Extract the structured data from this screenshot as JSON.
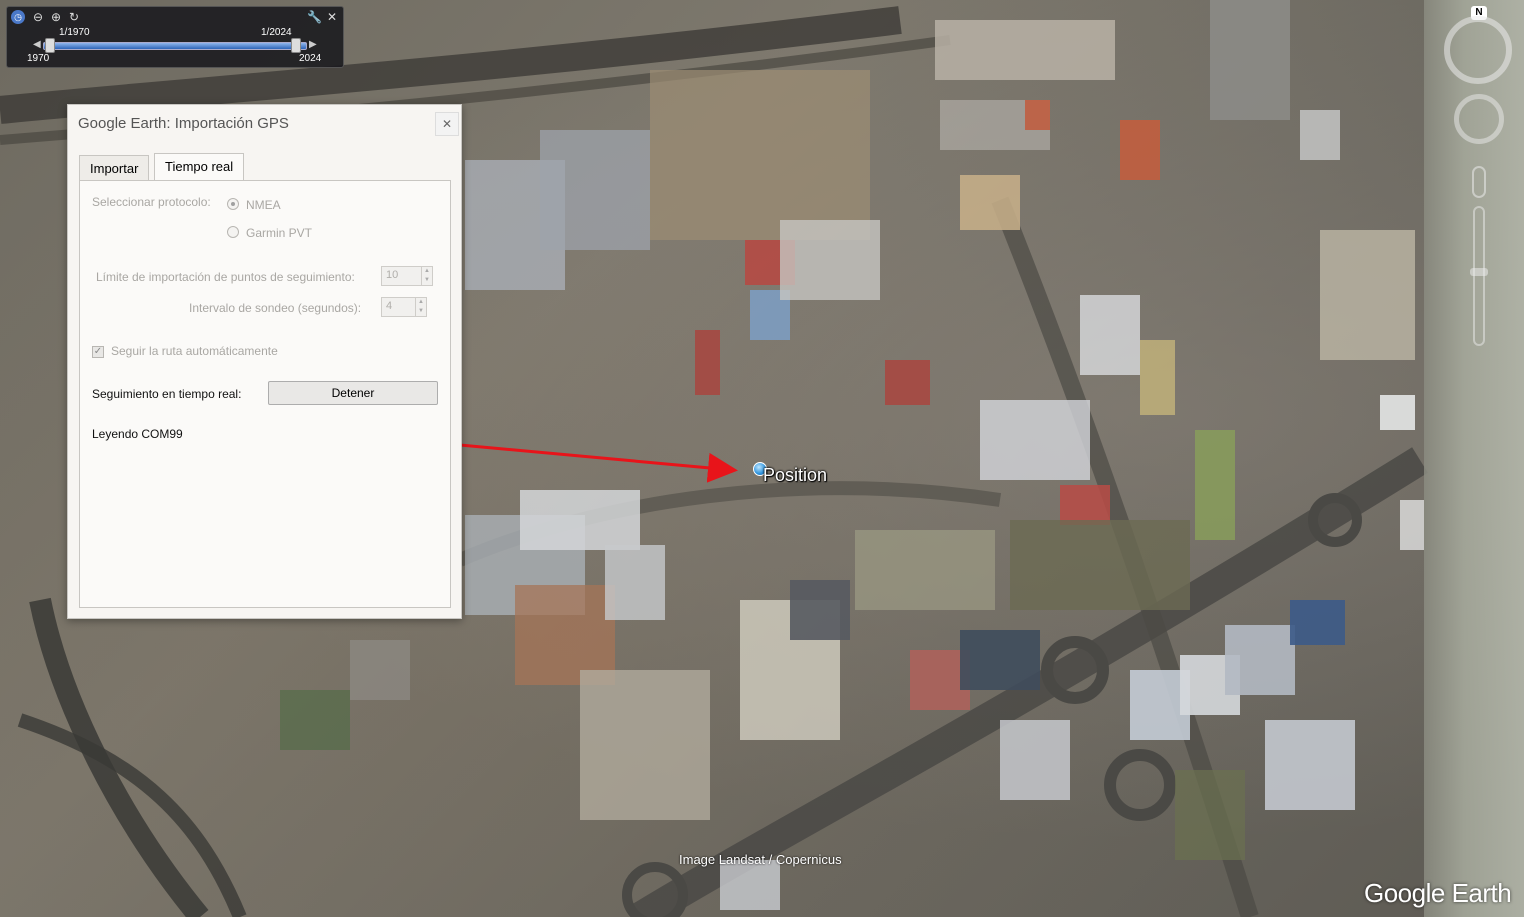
{
  "timebar": {
    "start_date_label": "1/1970",
    "end_date_label": "1/2024",
    "start_year": "1970",
    "end_year": "2024"
  },
  "nav": {
    "north": "N"
  },
  "dialog": {
    "title": "Google Earth: Importación GPS",
    "close": "✕",
    "tabs": [
      {
        "label": "Importar",
        "active": false
      },
      {
        "label": "Tiempo real",
        "active": true
      }
    ],
    "protocol_label": "Seleccionar protocolo:",
    "protocol_options": [
      {
        "label": "NMEA",
        "selected": true
      },
      {
        "label": "Garmin PVT",
        "selected": false
      }
    ],
    "limit_label": "Límite de importación de puntos de seguimiento:",
    "limit_value": "10",
    "interval_label": "Intervalo de sondeo (segundos):",
    "interval_value": "4",
    "follow_label": "Seguir la ruta automáticamente",
    "follow_checked": true,
    "tracking_label": "Seguimiento en tiempo real:",
    "stop_button": "Detener",
    "status": "Leyendo COM99"
  },
  "map": {
    "position_label": "Position",
    "attribution": "Image Landsat / Copernicus",
    "logo": "Google Earth",
    "arrow_color": "#e8141a"
  }
}
